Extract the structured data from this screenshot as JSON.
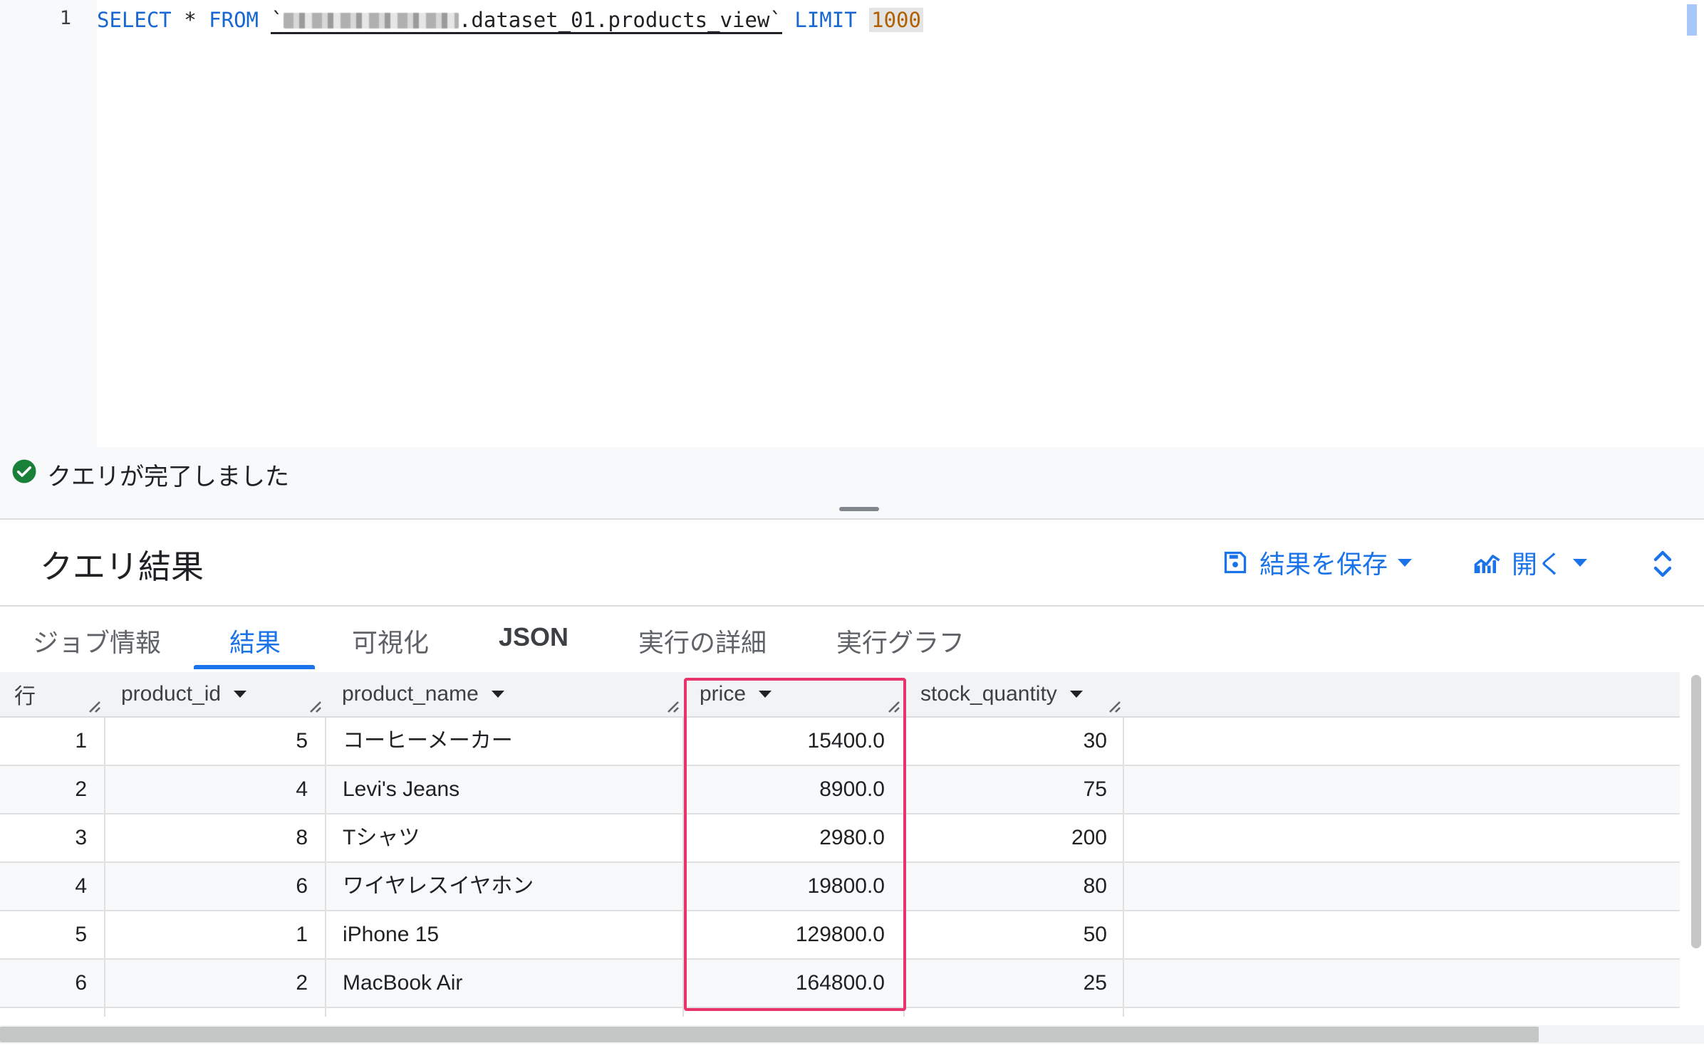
{
  "editor": {
    "line_number": "1",
    "kw_select": "SELECT",
    "star": " * ",
    "kw_from": "FROM",
    "backtick_open": "`",
    "table_suffix": ".dataset_01.products_view`",
    "kw_limit": "LIMIT",
    "limit_value": "1000"
  },
  "status": {
    "text": "クエリが完了しました",
    "icon": "check-circle-icon",
    "color": "#188038"
  },
  "results": {
    "title": "クエリ結果",
    "save_label": "結果を保存",
    "open_label": "開く"
  },
  "tabs": [
    {
      "label": "ジョブ情報"
    },
    {
      "label": "結果"
    },
    {
      "label": "可視化"
    },
    {
      "label": "JSON"
    },
    {
      "label": "実行の詳細"
    },
    {
      "label": "実行グラフ"
    }
  ],
  "active_tab": "結果",
  "table": {
    "columns": [
      "行",
      "product_id",
      "product_name",
      "price",
      "stock_quantity"
    ],
    "rows": [
      {
        "row": "1",
        "product_id": "5",
        "product_name": "コーヒーメーカー",
        "price": "15400.0",
        "stock_quantity": "30"
      },
      {
        "row": "2",
        "product_id": "4",
        "product_name": "Levi's Jeans",
        "price": "8900.0",
        "stock_quantity": "75"
      },
      {
        "row": "3",
        "product_id": "8",
        "product_name": "Tシャツ",
        "price": "2980.0",
        "stock_quantity": "200"
      },
      {
        "row": "4",
        "product_id": "6",
        "product_name": "ワイヤレスイヤホン",
        "price": "19800.0",
        "stock_quantity": "80"
      },
      {
        "row": "5",
        "product_id": "1",
        "product_name": "iPhone 15",
        "price": "129800.0",
        "stock_quantity": "50"
      },
      {
        "row": "6",
        "product_id": "2",
        "product_name": "MacBook Air",
        "price": "164800.0",
        "stock_quantity": "25"
      }
    ]
  },
  "colors": {
    "accent": "#1a73e8",
    "highlight": "#e8336d"
  }
}
